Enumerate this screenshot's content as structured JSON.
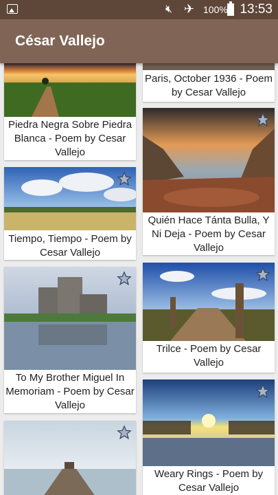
{
  "status": {
    "battery": "100%",
    "time": "13:53"
  },
  "appbar": {
    "title": "César Vallejo"
  },
  "left": [
    {
      "caption": "Piedra Negra Sobre Piedra Blanca - Poem by Cesar Vallejo"
    },
    {
      "caption": "Tiempo, Tiempo - Poem by Cesar Vallejo"
    },
    {
      "caption": "To My Brother Miguel In Memoriam - Poem by Cesar Vallejo"
    },
    {
      "caption": ""
    }
  ],
  "right": [
    {
      "caption": "Paris, October 1936 - Poem by Cesar Vallejo"
    },
    {
      "caption": "Quién Hace Tánta Bulla, Y Ni Deja - Poem by Cesar Vallejo"
    },
    {
      "caption": "Trilce - Poem by Cesar Vallejo"
    },
    {
      "caption": "Weary Rings - Poem by Cesar Vallejo"
    }
  ]
}
